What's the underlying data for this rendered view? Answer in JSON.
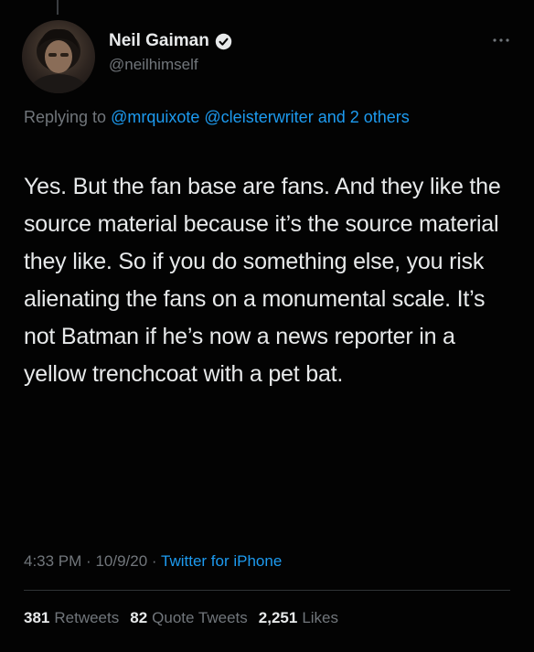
{
  "author": {
    "display_name": "Neil Gaiman",
    "handle": "@neilhimself",
    "verified": true
  },
  "reply": {
    "prefix": "Replying to",
    "users": [
      "@mrquixote",
      "@cleisterwriter"
    ],
    "and_others": "and 2 others"
  },
  "tweet": {
    "text": "Yes. But the fan base are fans. And they like the source material because it’s the source material they like. So if you do something else, you risk alienating the fans on a monumental scale. It’s not Batman if he’s now a news reporter in a yellow trenchcoat with a pet bat."
  },
  "meta": {
    "time": "4:33 PM",
    "date": "10/9/20",
    "separator": "·",
    "source": "Twitter for iPhone"
  },
  "stats": {
    "retweets_count": "381",
    "retweets_label": "Retweets",
    "quotes_count": "82",
    "quotes_label": "Quote Tweets",
    "likes_count": "2,251",
    "likes_label": "Likes"
  },
  "colors": {
    "background": "#030303",
    "text": "#e7e9ea",
    "secondary": "#71767b",
    "link": "#1d9bf0",
    "divider": "#2f3336"
  },
  "icons": {
    "verified": "verified-badge-icon",
    "more": "more-options-icon"
  }
}
